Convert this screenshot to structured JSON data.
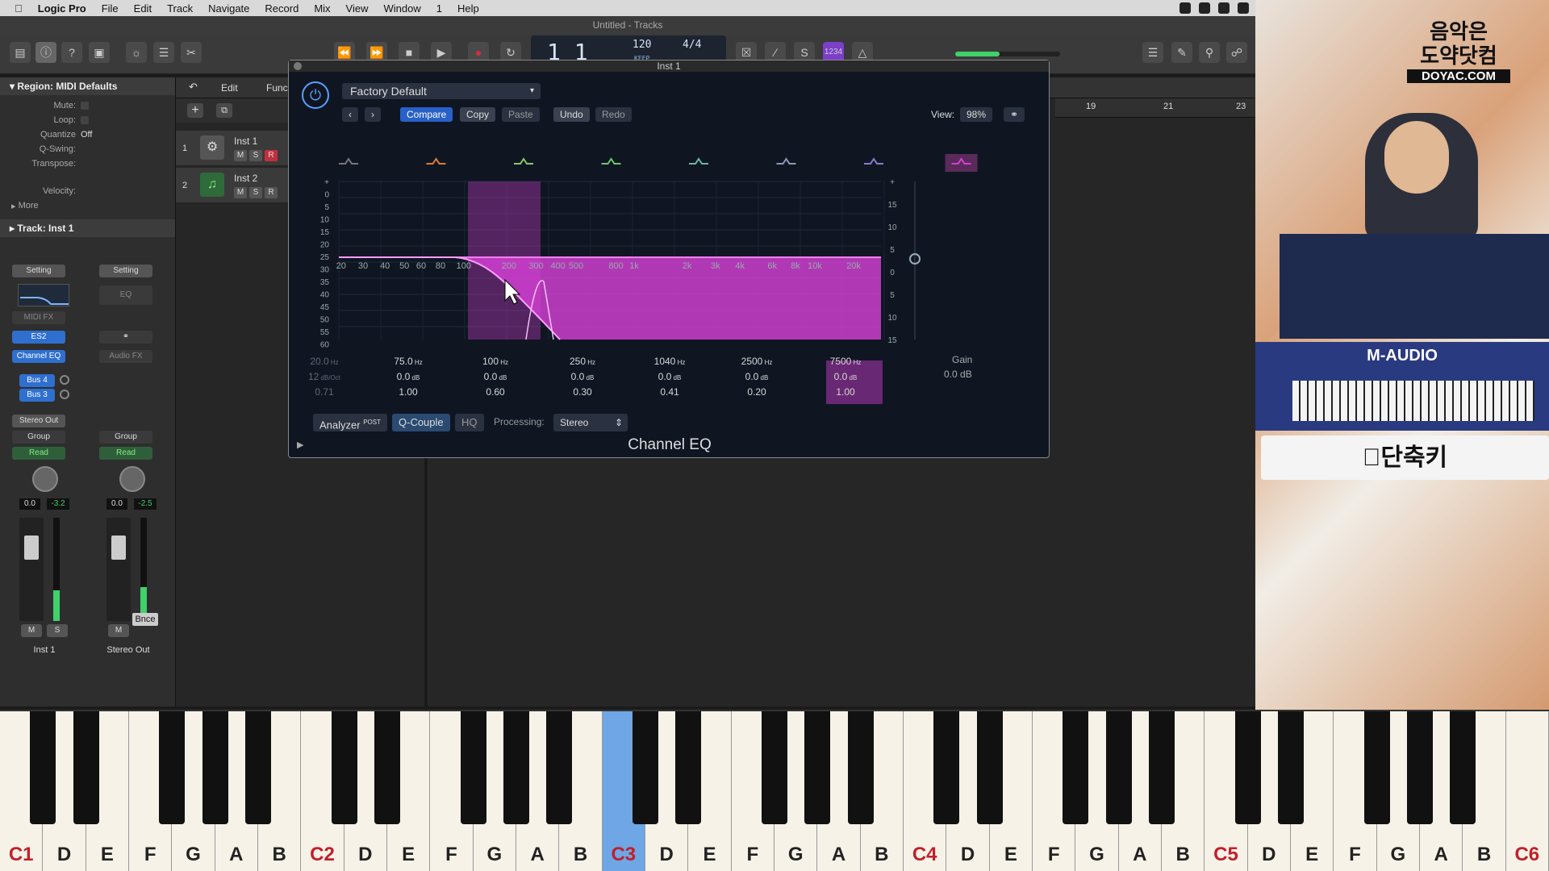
{
  "menu": {
    "app": "Logic Pro",
    "items": [
      "File",
      "Edit",
      "Track",
      "Navigate",
      "Record",
      "Mix",
      "View",
      "Window",
      "1",
      "Help"
    ]
  },
  "window": {
    "title": "Untitled - Tracks"
  },
  "lcd": {
    "position": "1 1",
    "tempo": "120",
    "keep": "KEEP",
    "signature": "4/4"
  },
  "inspector": {
    "region_header": "Region: MIDI Defaults",
    "rows": [
      {
        "label": "Mute:",
        "value": ""
      },
      {
        "label": "Loop:",
        "value": ""
      },
      {
        "label": "Quantize",
        "value": "Off"
      },
      {
        "label": "Q-Swing:",
        "value": ""
      },
      {
        "label": "Transpose:",
        "value": ""
      },
      {
        "label": "Velocity:",
        "value": ""
      }
    ],
    "more": "More",
    "track_header": "Track:  Inst 1"
  },
  "strip1": {
    "setting": "Setting",
    "midi_fx": "MIDI FX",
    "instrument": "ES2",
    "effect": "Channel EQ",
    "send1": "Bus 4",
    "send2": "Bus 3",
    "output": "Stereo Out",
    "group": "Group",
    "automation": "Read",
    "vol": "0.0",
    "peak": "-3.2",
    "m": "M",
    "s": "S",
    "name": "Inst 1",
    "level": 0.3
  },
  "strip2": {
    "setting": "Setting",
    "eq": "EQ",
    "audio_fx": "Audio FX",
    "group": "Group",
    "automation": "Read",
    "vol": "0.0",
    "peak": "-2.5",
    "bounce": "Bnce",
    "m": "M",
    "name": "Stereo Out",
    "level": 0.33
  },
  "tracks_area": {
    "edit": "Edit",
    "functions": "Func",
    "ruler": [
      "19",
      "21",
      "23"
    ],
    "tracks": [
      {
        "num": "1",
        "name": "Inst 1",
        "m": "M",
        "s": "S",
        "r": "R"
      },
      {
        "num": "2",
        "name": "Inst 2",
        "m": "M",
        "s": "S",
        "r": "R"
      }
    ]
  },
  "plugin": {
    "window_title": "Inst 1",
    "preset": "Factory Default",
    "compare": "Compare",
    "copy": "Copy",
    "paste": "Paste",
    "undo": "Undo",
    "redo": "Redo",
    "view_label": "View:",
    "view_value": "98%",
    "name": "Channel EQ",
    "analyzer": "Analyzer",
    "analyzer_post": "POST",
    "q_couple": "Q-Couple",
    "hq": "HQ",
    "processing_label": "Processing:",
    "processing_value": "Stereo",
    "gain_label": "Gain",
    "gain_value": "0.0 dB",
    "freq_ticks": [
      "20",
      "30",
      "40",
      "50",
      "60",
      "80",
      "100",
      "200",
      "300",
      "400",
      "500",
      "800",
      "1k",
      "2k",
      "3k",
      "4k",
      "6k",
      "8k",
      "10k",
      "20k"
    ],
    "db_ticks_left": [
      "+",
      "0",
      "5",
      "10",
      "15",
      "20",
      "25",
      "30",
      "35",
      "40",
      "45",
      "50",
      "55",
      "60"
    ],
    "db_ticks_right": [
      "+",
      "15",
      "10",
      "5",
      "0",
      "5",
      "10",
      "15"
    ],
    "bands": [
      {
        "freq": "20.0",
        "unit": "Hz",
        "gain": "12",
        "gunit": "dB/Oct",
        "q": "0.71",
        "dim": true
      },
      {
        "freq": "75.0",
        "unit": "Hz",
        "gain": "0.0",
        "gunit": "dB",
        "q": "1.00",
        "dim": false
      },
      {
        "freq": "100",
        "unit": "Hz",
        "gain": "0.0",
        "gunit": "dB",
        "q": "0.60",
        "dim": false
      },
      {
        "freq": "250",
        "unit": "Hz",
        "gain": "0.0",
        "gunit": "dB",
        "q": "0.30",
        "dim": false
      },
      {
        "freq": "1040",
        "unit": "Hz",
        "gain": "0.0",
        "gunit": "dB",
        "q": "0.41",
        "dim": false
      },
      {
        "freq": "2500",
        "unit": "Hz",
        "gain": "0.0",
        "gunit": "dB",
        "q": "0.20",
        "dim": false
      },
      {
        "freq": "7500",
        "unit": "Hz",
        "gain": "0.0",
        "gunit": "dB",
        "q": "1.00",
        "dim": false
      },
      {
        "freq": "",
        "unit": "",
        "gain": "",
        "gunit": "",
        "q": "",
        "dim": true
      }
    ]
  },
  "overlay": {
    "logo_line1": "음악은",
    "logo_line2": "도약닷컴",
    "logo_line3": "DOYAC.COM",
    "keyboard_brand": "M-AUDIO",
    "shortcut": "단축키"
  },
  "piano": {
    "white_keys": [
      "C1",
      "D",
      "E",
      "F",
      "G",
      "A",
      "B",
      "C2",
      "D",
      "E",
      "F",
      "G",
      "A",
      "B",
      "C3",
      "D",
      "E",
      "F",
      "G",
      "A",
      "B",
      "C4",
      "D",
      "E",
      "F",
      "G",
      "A",
      "B",
      "C5",
      "D",
      "E",
      "F",
      "G",
      "A",
      "B",
      "C6"
    ],
    "highlighted": "C3"
  },
  "colors": {
    "accent": "#2860c8",
    "eq_fill": "#d63fd6",
    "record": "#e0283a",
    "meter": "#3fd16a"
  }
}
